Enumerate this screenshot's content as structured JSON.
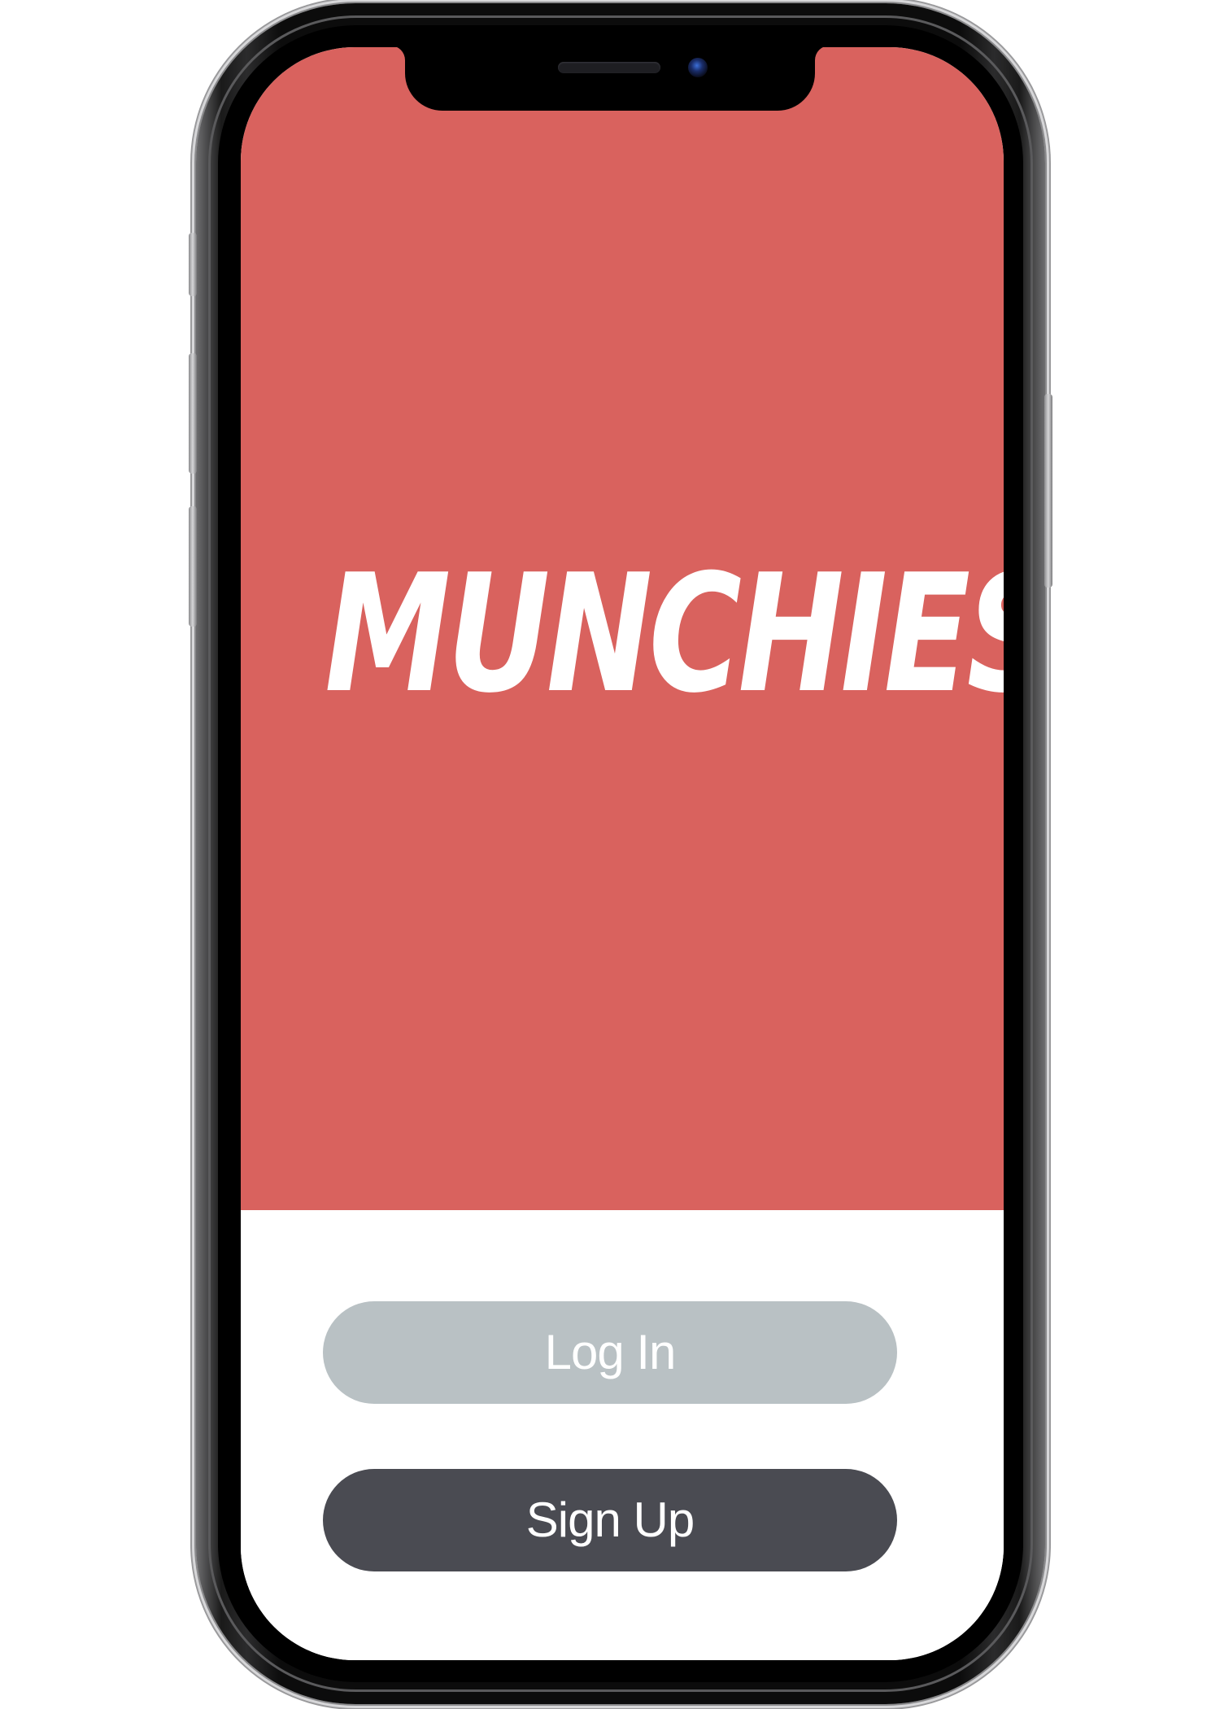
{
  "app": {
    "logo_text": "MUNCHIES"
  },
  "auth": {
    "login_label": "Log In",
    "signup_label": "Sign Up"
  },
  "colors": {
    "hero_background": "#d9625e",
    "login_button": "#b9c1c4",
    "signup_button": "#4a4b52",
    "button_text": "#ffffff",
    "screen_background": "#ffffff"
  }
}
